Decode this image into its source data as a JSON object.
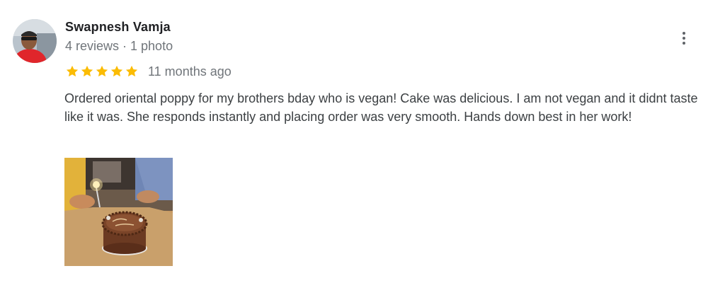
{
  "reviewer": {
    "name": "Swapnesh Vamja",
    "meta": "4 reviews · 1 photo"
  },
  "review": {
    "rating": 5,
    "rating_max": 5,
    "date": "11 months ago",
    "text": "Ordered oriental poppy for my brothers bday who is vegan! Cake was delicious. I am not vegan and it didnt taste like it was. She responds instantly and placing order was very smooth. Hands down best in her work!"
  },
  "icons": {
    "star_color": "#fbbc04",
    "menu": "more-vert-icon"
  },
  "photo": {
    "count": 1
  }
}
